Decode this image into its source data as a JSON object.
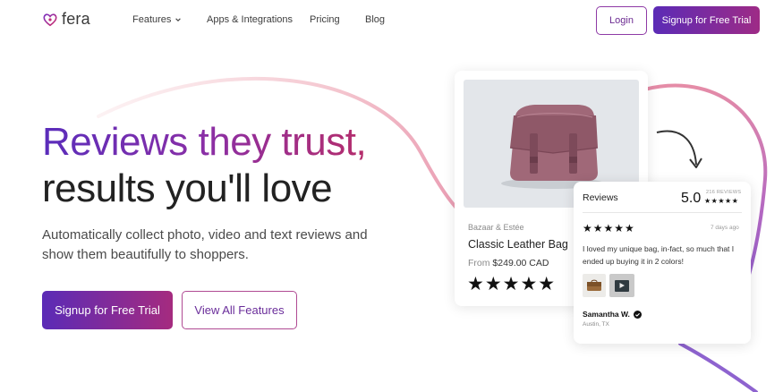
{
  "brand": {
    "logo_text": "fera",
    "accent_start": "#5b2bb6",
    "accent_end": "#a52b7f"
  },
  "nav": {
    "items": [
      {
        "label": "Features",
        "icon": "chevron-down-icon"
      },
      {
        "label": "Apps & Integrations"
      },
      {
        "label": "Pricing"
      },
      {
        "label": "Blog"
      }
    ],
    "login_label": "Login",
    "signup_label": "Signup for Free Trial"
  },
  "hero": {
    "title_line1": "Reviews they trust,",
    "title_line2": "results you'll love",
    "subtitle": "Automatically collect photo, video and text reviews and show them beautifully to shoppers.",
    "primary_cta": "Signup for Free Trial",
    "secondary_cta": "View All Features"
  },
  "product_card": {
    "brand": "Bazaar & Estée",
    "name": "Classic Leather Bag",
    "price_prefix": "From",
    "price": "$249.00 CAD",
    "stars": "★★★★★",
    "rating": 5
  },
  "review_card": {
    "title": "Reviews",
    "score": "5.0",
    "count": "216 REVIEWS",
    "count_stars": "★★★★★",
    "review_stars": "★★★★★",
    "date": "7 days ago",
    "text": "I loved my unique bag, in-fact, so much that I ended up buying it in 2 colors!",
    "author": "Samantha W.",
    "location": "Austin, TX"
  }
}
